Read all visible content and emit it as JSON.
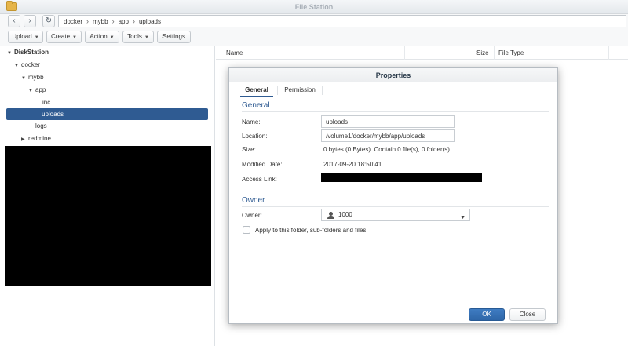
{
  "window": {
    "title": "File Station"
  },
  "nav": {
    "back_icon": "‹",
    "forward_icon": "›",
    "refresh_icon": "↻",
    "breadcrumb": [
      "docker",
      "mybb",
      "app",
      "uploads"
    ],
    "separator": "›"
  },
  "toolbar": {
    "upload": "Upload",
    "create": "Create",
    "action": "Action",
    "tools": "Tools",
    "settings": "Settings"
  },
  "tree": {
    "root": "DiskStation",
    "docker": "docker",
    "mybb": "mybb",
    "app": "app",
    "inc": "inc",
    "uploads": "uploads",
    "logs": "logs",
    "redmine": "redmine"
  },
  "columns": {
    "name": "Name",
    "size": "Size",
    "file_type": "File Type"
  },
  "dialog": {
    "title": "Properties",
    "tabs": {
      "general": "General",
      "permission": "Permission"
    },
    "general_section": "General",
    "owner_section": "Owner",
    "labels": {
      "name": "Name:",
      "location": "Location:",
      "size": "Size:",
      "modified": "Modified Date:",
      "access_link": "Access Link:",
      "owner": "Owner:"
    },
    "values": {
      "name": "uploads",
      "location": "/volume1/docker/mybb/app/uploads",
      "size": "0 bytes (0 Bytes). Contain 0 file(s), 0 folder(s)",
      "modified": "2017-09-20 18:50:41",
      "owner": "1000"
    },
    "apply_label": "Apply to this folder, sub-folders and files",
    "ok": "OK",
    "close": "Close"
  },
  "colors": {
    "accent": "#2f5b92",
    "selected_bg": "#2f5b92",
    "ok_button": "#3a74b8"
  }
}
